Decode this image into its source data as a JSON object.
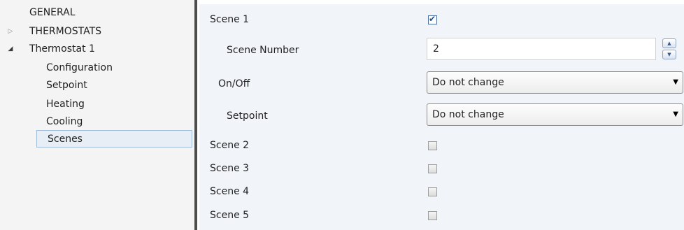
{
  "tree": {
    "items": [
      {
        "label": "GENERAL"
      },
      {
        "label": "THERMOSTATS",
        "arrow": "▷"
      },
      {
        "label": "Thermostat 1",
        "arrow": "◢"
      },
      {
        "label": "Configuration"
      },
      {
        "label": "Setpoint"
      },
      {
        "label": "Heating"
      },
      {
        "label": "Cooling"
      },
      {
        "label": "Scenes"
      }
    ]
  },
  "panel": {
    "scene1": {
      "label": "Scene 1",
      "checked": true
    },
    "scene_number": {
      "label": "Scene Number",
      "value": "2",
      "up": "▲",
      "down": "▼"
    },
    "onoff": {
      "label": "On/Off",
      "value": "Do not change",
      "caret": "▼"
    },
    "setpoint": {
      "label": "Setpoint",
      "value": "Do not change",
      "caret": "▼"
    },
    "scene2": {
      "label": "Scene 2",
      "checked": false
    },
    "scene3": {
      "label": "Scene 3",
      "checked": false
    },
    "scene4": {
      "label": "Scene 4",
      "checked": false
    },
    "scene5": {
      "label": "Scene 5",
      "checked": false
    }
  },
  "colors": {
    "selection_border": "#9dbbd9",
    "splitter": "#4d4d4d",
    "panel_bg": "#f1f4f8"
  }
}
